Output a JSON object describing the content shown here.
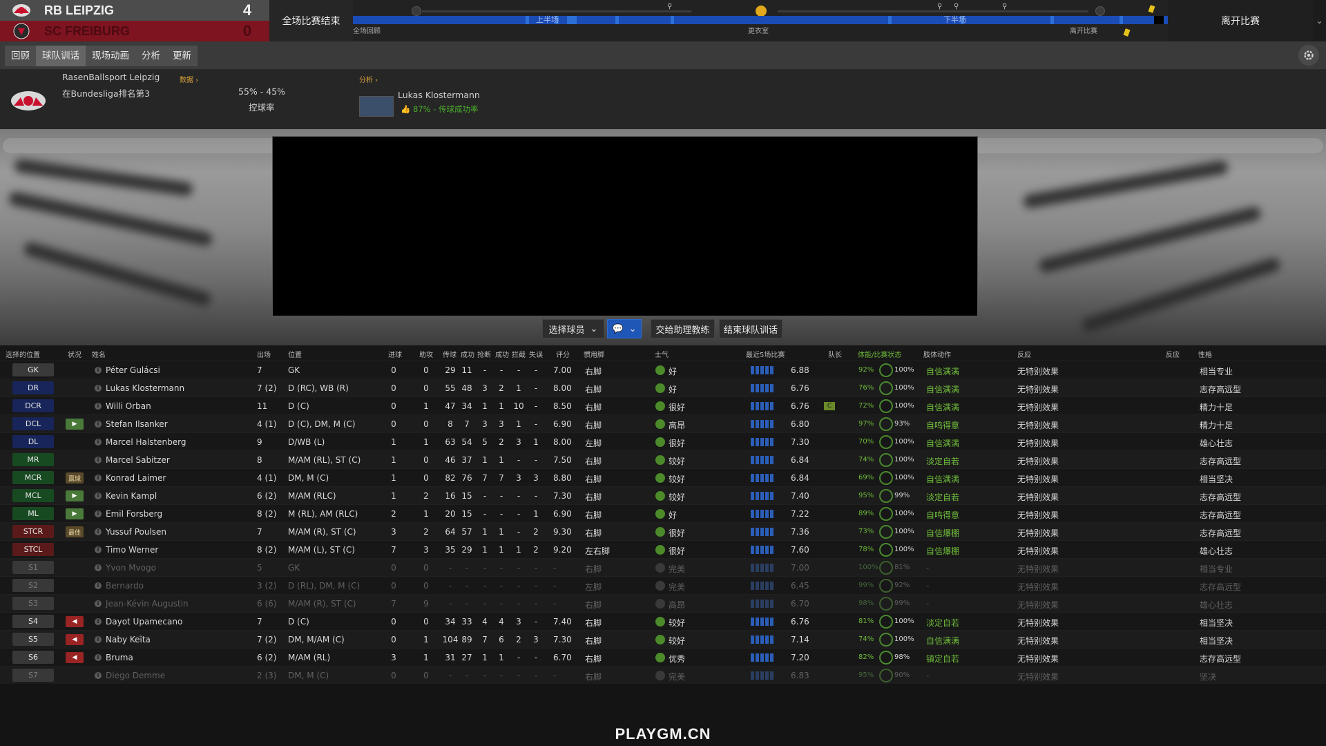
{
  "scoreboard": {
    "home": {
      "name": "RB LEIPZIG",
      "score": "4"
    },
    "away": {
      "name": "SC FREIBURG",
      "score": "0"
    },
    "status": "全场比赛结束",
    "leave_label": "离开比赛"
  },
  "timeline": {
    "first_half": "上半场",
    "second_half": "下半场",
    "marks": [
      "全场回顾",
      "更衣室",
      "离开比赛"
    ]
  },
  "tabs": [
    "回顾",
    "球队训话",
    "现场动画",
    "分析",
    "更新"
  ],
  "active_tab": "球队训话",
  "info": {
    "club_name": "RasenBallsport Leipzig",
    "club_rank": "在Bundesliga排名第3",
    "data_link": "数据 ›",
    "possession": "55% - 45%",
    "possession_label": "控球率",
    "analysis_link": "分析 ›",
    "player_name": "Lukas Klostermann",
    "player_stat": "87% - 传球成功率"
  },
  "controls": {
    "select_player": "选择球员",
    "assistant": "交给助理教练",
    "end_talk": "结束球队训话"
  },
  "table": {
    "headers": [
      "选择的位置",
      "状况",
      "姓名",
      "出场",
      "位置",
      "进球",
      "助攻",
      "传球",
      "成功",
      "抢断",
      "成功",
      "拦截",
      "失误",
      "评分",
      "惯用脚",
      "士气",
      "最近5场比赛",
      "队长",
      "体能/比赛状态",
      "肢体动作",
      "反应",
      "反应",
      "性格"
    ],
    "rows": [
      {
        "pos": "GK",
        "cls": "pos-gk",
        "status": "",
        "name": "Péter Gulácsi",
        "apps": "7",
        "position": "GK",
        "gls": "0",
        "ast": "0",
        "pas": "29",
        "pasok": "11",
        "tck": "-",
        "tckok": "-",
        "int": "-",
        "err": "-",
        "rating": "7.00",
        "foot": "右脚",
        "morale": "好",
        "avg": "6.88",
        "captain": "",
        "cond": "92%",
        "sharp": "100%",
        "body": "自信满满",
        "react": "无特别效果",
        "pers": "相当专业",
        "dim": false
      },
      {
        "pos": "DR",
        "cls": "pos-def",
        "status": "",
        "name": "Lukas Klostermann",
        "apps": "7 (2)",
        "position": "D (RC), WB (R)",
        "gls": "0",
        "ast": "0",
        "pas": "55",
        "pasok": "48",
        "tck": "3",
        "tckok": "2",
        "int": "1",
        "err": "-",
        "rating": "8.00",
        "foot": "右脚",
        "morale": "好",
        "avg": "6.76",
        "captain": "",
        "cond": "76%",
        "sharp": "100%",
        "body": "自信满满",
        "react": "无特别效果",
        "pers": "志存高远型",
        "dim": false
      },
      {
        "pos": "DCR",
        "cls": "pos-def",
        "status": "",
        "name": "Willi Orban",
        "apps": "11",
        "position": "D (C)",
        "gls": "0",
        "ast": "1",
        "pas": "47",
        "pasok": "34",
        "tck": "1",
        "tckok": "1",
        "int": "10",
        "err": "-",
        "rating": "8.50",
        "foot": "右脚",
        "morale": "很好",
        "avg": "6.76",
        "captain": "C",
        "cond": "72%",
        "sharp": "100%",
        "body": "自信满满",
        "react": "无特别效果",
        "pers": "精力十足",
        "dim": false
      },
      {
        "pos": "DCL",
        "cls": "pos-def",
        "status": "▶",
        "stcls": "st-green",
        "name": "Stefan Ilsanker",
        "apps": "4 (1)",
        "position": "D (C), DM, M (C)",
        "gls": "0",
        "ast": "0",
        "pas": "8",
        "pasok": "7",
        "tck": "3",
        "tckok": "3",
        "int": "1",
        "err": "-",
        "rating": "6.90",
        "foot": "右脚",
        "morale": "高昂",
        "avg": "6.80",
        "captain": "",
        "cond": "97%",
        "sharp": "93%",
        "body": "自鸣得意",
        "react": "无特别效果",
        "pers": "精力十足",
        "dim": false
      },
      {
        "pos": "DL",
        "cls": "pos-def",
        "status": "",
        "name": "Marcel Halstenberg",
        "apps": "9",
        "position": "D/WB (L)",
        "gls": "1",
        "ast": "1",
        "pas": "63",
        "pasok": "54",
        "tck": "5",
        "tckok": "2",
        "int": "3",
        "err": "1",
        "rating": "8.00",
        "foot": "左脚",
        "morale": "很好",
        "avg": "7.30",
        "captain": "",
        "cond": "70%",
        "sharp": "100%",
        "body": "自信满满",
        "react": "无特别效果",
        "pers": "雄心壮志",
        "dim": false
      },
      {
        "pos": "MR",
        "cls": "pos-mid",
        "status": "",
        "name": "Marcel Sabitzer",
        "apps": "8",
        "position": "M/AM (RL), ST (C)",
        "gls": "1",
        "ast": "0",
        "pas": "46",
        "pasok": "37",
        "tck": "1",
        "tckok": "1",
        "int": "-",
        "err": "-",
        "rating": "7.50",
        "foot": "右脚",
        "morale": "较好",
        "avg": "6.84",
        "captain": "",
        "cond": "74%",
        "sharp": "100%",
        "body": "淡定自若",
        "react": "无特别效果",
        "pers": "志存高远型",
        "dim": false
      },
      {
        "pos": "MCR",
        "cls": "pos-mid",
        "status": "赢球",
        "stcls": "st-tag",
        "name": "Konrad Laimer",
        "apps": "4 (1)",
        "position": "DM, M (C)",
        "gls": "1",
        "ast": "0",
        "pas": "82",
        "pasok": "76",
        "tck": "7",
        "tckok": "7",
        "int": "3",
        "err": "3",
        "rating": "8.80",
        "foot": "右脚",
        "morale": "较好",
        "avg": "6.84",
        "captain": "",
        "cond": "69%",
        "sharp": "100%",
        "body": "自信满满",
        "react": "无特别效果",
        "pers": "相当坚决",
        "dim": false
      },
      {
        "pos": "MCL",
        "cls": "pos-mid",
        "status": "▶",
        "stcls": "st-green",
        "name": "Kevin Kampl",
        "apps": "6 (2)",
        "position": "M/AM (RLC)",
        "gls": "1",
        "ast": "2",
        "pas": "16",
        "pasok": "15",
        "tck": "-",
        "tckok": "-",
        "int": "-",
        "err": "-",
        "rating": "7.30",
        "foot": "右脚",
        "morale": "较好",
        "avg": "7.40",
        "captain": "",
        "cond": "95%",
        "sharp": "99%",
        "body": "淡定自若",
        "react": "无特别效果",
        "pers": "志存高远型",
        "dim": false
      },
      {
        "pos": "ML",
        "cls": "pos-mid",
        "status": "▶",
        "stcls": "st-green",
        "name": "Emil Forsberg",
        "apps": "8 (2)",
        "position": "M (RL), AM (RLC)",
        "gls": "2",
        "ast": "1",
        "pas": "20",
        "pasok": "15",
        "tck": "-",
        "tckok": "-",
        "int": "-",
        "err": "1",
        "rating": "6.90",
        "foot": "右脚",
        "morale": "好",
        "avg": "7.22",
        "captain": "",
        "cond": "89%",
        "sharp": "100%",
        "body": "自鸣得意",
        "react": "无特别效果",
        "pers": "志存高远型",
        "dim": false
      },
      {
        "pos": "STCR",
        "cls": "pos-att",
        "status": "最佳",
        "stcls": "st-tag",
        "name": "Yussuf Poulsen",
        "apps": "7",
        "position": "M/AM (R), ST (C)",
        "gls": "3",
        "ast": "2",
        "pas": "64",
        "pasok": "57",
        "tck": "1",
        "tckok": "1",
        "int": "-",
        "err": "2",
        "rating": "9.30",
        "foot": "右脚",
        "morale": "很好",
        "avg": "7.36",
        "captain": "",
        "cond": "73%",
        "sharp": "100%",
        "body": "自信爆棚",
        "react": "无特别效果",
        "pers": "志存高远型",
        "dim": false
      },
      {
        "pos": "STCL",
        "cls": "pos-att",
        "status": "",
        "name": "Timo Werner",
        "apps": "8 (2)",
        "position": "M/AM (L), ST (C)",
        "gls": "7",
        "ast": "3",
        "pas": "35",
        "pasok": "29",
        "tck": "1",
        "tckok": "1",
        "int": "1",
        "err": "2",
        "rating": "9.20",
        "foot": "左右脚",
        "morale": "很好",
        "avg": "7.60",
        "captain": "",
        "cond": "78%",
        "sharp": "100%",
        "body": "自信爆棚",
        "react": "无特别效果",
        "pers": "雄心壮志",
        "dim": false
      },
      {
        "pos": "S1",
        "cls": "pos-sub",
        "status": "",
        "name": "Yvon Mvogo",
        "apps": "5",
        "position": "GK",
        "gls": "0",
        "ast": "0",
        "pas": "-",
        "pasok": "-",
        "tck": "-",
        "tckok": "-",
        "int": "-",
        "err": "-",
        "rating": "-",
        "foot": "右脚",
        "morale": "完美",
        "avg": "7.00",
        "captain": "",
        "cond": "100%",
        "sharp": "81%",
        "body": "-",
        "react": "无特别效果",
        "pers": "相当专业",
        "dim": true
      },
      {
        "pos": "S2",
        "cls": "pos-sub",
        "status": "",
        "name": "Bernardo",
        "apps": "3 (2)",
        "position": "D (RL), DM, M (C)",
        "gls": "0",
        "ast": "0",
        "pas": "-",
        "pasok": "-",
        "tck": "-",
        "tckok": "-",
        "int": "-",
        "err": "-",
        "rating": "-",
        "foot": "左脚",
        "morale": "完美",
        "avg": "6.45",
        "captain": "",
        "cond": "99%",
        "sharp": "92%",
        "body": "-",
        "react": "无特别效果",
        "pers": "志存高远型",
        "dim": true
      },
      {
        "pos": "S3",
        "cls": "pos-sub",
        "status": "",
        "name": "Jean-Kévin Augustin",
        "apps": "6 (6)",
        "position": "M/AM (R), ST (C)",
        "gls": "7",
        "ast": "9",
        "pas": "-",
        "pasok": "-",
        "tck": "-",
        "tckok": "-",
        "int": "-",
        "err": "-",
        "rating": "-",
        "foot": "右脚",
        "morale": "高昂",
        "avg": "6.70",
        "captain": "",
        "cond": "98%",
        "sharp": "99%",
        "body": "-",
        "react": "无特别效果",
        "pers": "雄心壮志",
        "dim": true
      },
      {
        "pos": "S4",
        "cls": "pos-sub",
        "status": "◀",
        "stcls": "st-red",
        "name": "Dayot Upamecano",
        "apps": "7",
        "position": "D (C)",
        "gls": "0",
        "ast": "0",
        "pas": "34",
        "pasok": "33",
        "tck": "4",
        "tckok": "4",
        "int": "3",
        "err": "-",
        "rating": "7.40",
        "foot": "右脚",
        "morale": "较好",
        "avg": "6.76",
        "captain": "",
        "cond": "81%",
        "sharp": "100%",
        "body": "淡定自若",
        "react": "无特别效果",
        "pers": "相当坚决",
        "dim": false
      },
      {
        "pos": "S5",
        "cls": "pos-sub",
        "status": "◀",
        "stcls": "st-red",
        "name": "Naby Keïta",
        "apps": "7 (2)",
        "position": "DM, M/AM (C)",
        "gls": "0",
        "ast": "1",
        "pas": "104",
        "pasok": "89",
        "tck": "7",
        "tckok": "6",
        "int": "2",
        "err": "3",
        "rating": "7.30",
        "foot": "右脚",
        "morale": "较好",
        "avg": "7.14",
        "captain": "",
        "cond": "74%",
        "sharp": "100%",
        "body": "自信满满",
        "react": "无特别效果",
        "pers": "相当坚决",
        "dim": false
      },
      {
        "pos": "S6",
        "cls": "pos-sub",
        "status": "◀",
        "stcls": "st-red",
        "name": "Bruma",
        "apps": "6 (2)",
        "position": "M/AM (RL)",
        "gls": "3",
        "ast": "1",
        "pas": "31",
        "pasok": "27",
        "tck": "1",
        "tckok": "1",
        "int": "-",
        "err": "-",
        "rating": "6.70",
        "foot": "右脚",
        "morale": "优秀",
        "avg": "7.20",
        "captain": "",
        "cond": "82%",
        "sharp": "98%",
        "body": "镇定自若",
        "react": "无特别效果",
        "pers": "志存高远型",
        "dim": false
      },
      {
        "pos": "S7",
        "cls": "pos-sub",
        "status": "",
        "name": "Diego Demme",
        "apps": "2 (3)",
        "position": "DM, M (C)",
        "gls": "0",
        "ast": "0",
        "pas": "-",
        "pasok": "-",
        "tck": "-",
        "tckok": "-",
        "int": "-",
        "err": "-",
        "rating": "-",
        "foot": "右脚",
        "morale": "完美",
        "avg": "6.83",
        "captain": "",
        "cond": "95%",
        "sharp": "90%",
        "body": "-",
        "react": "无特别效果",
        "pers": "坚决",
        "dim": true
      }
    ]
  },
  "watermark": "PLAYGM.CN"
}
